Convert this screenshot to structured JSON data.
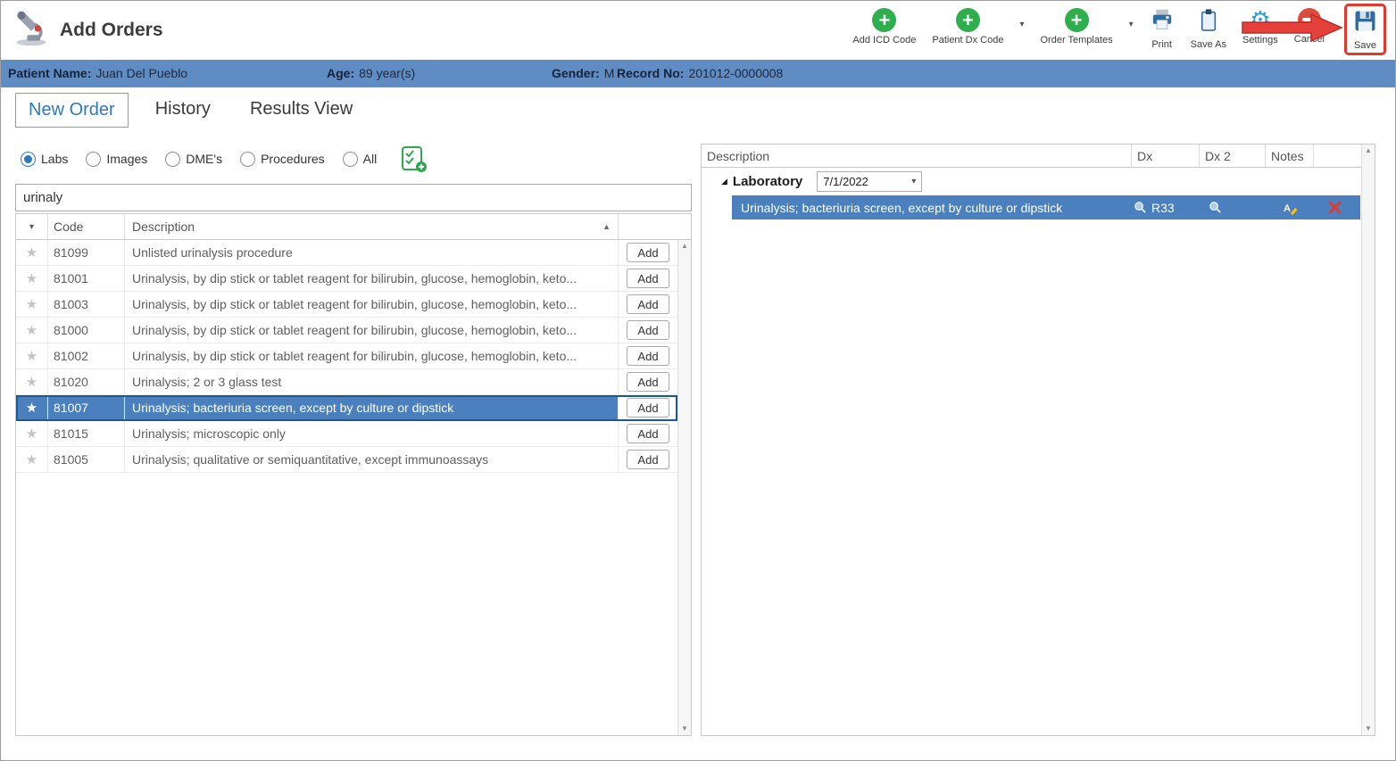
{
  "window": {
    "title": "Add Orders"
  },
  "toolbar": {
    "add_icd": "Add ICD Code",
    "patient_dx": "Patient Dx Code",
    "order_templates": "Order Templates",
    "print": "Print",
    "save_as": "Save As",
    "settings": "Settings",
    "cancel": "Cancel",
    "save": "Save"
  },
  "patient_bar": {
    "name_label": "Patient Name:",
    "name_value": "Juan Del Pueblo",
    "age_label": "Age:",
    "age_value": "89 year(s)",
    "gender_label": "Gender:",
    "gender_value": "M",
    "record_label": "Record No:",
    "record_value": "201012-0000008"
  },
  "tabs": {
    "new_order": "New Order",
    "history": "History",
    "results_view": "Results View"
  },
  "filters": {
    "labs": "Labs",
    "images": "Images",
    "dmes": "DME's",
    "procedures": "Procedures",
    "all": "All",
    "selected": "Labs"
  },
  "search": {
    "value": "urinaly"
  },
  "codes_table": {
    "col_code": "Code",
    "col_description": "Description",
    "add_label": "Add",
    "selected_code": "81007",
    "rows": [
      {
        "code": "81099",
        "description": "Unlisted urinalysis procedure"
      },
      {
        "code": "81001",
        "description": "Urinalysis, by dip stick or tablet reagent for bilirubin, glucose, hemoglobin, keto..."
      },
      {
        "code": "81003",
        "description": "Urinalysis, by dip stick or tablet reagent for bilirubin, glucose, hemoglobin, keto..."
      },
      {
        "code": "81000",
        "description": "Urinalysis, by dip stick or tablet reagent for bilirubin, glucose, hemoglobin, keto..."
      },
      {
        "code": "81002",
        "description": "Urinalysis, by dip stick or tablet reagent for bilirubin, glucose, hemoglobin, keto..."
      },
      {
        "code": "81020",
        "description": "Urinalysis; 2 or 3 glass test"
      },
      {
        "code": "81007",
        "description": "Urinalysis; bacteriuria screen, except by culture or dipstick"
      },
      {
        "code": "81015",
        "description": "Urinalysis; microscopic only"
      },
      {
        "code": "81005",
        "description": "Urinalysis; qualitative or semiquantitative, except immunoassays"
      }
    ]
  },
  "orders_panel": {
    "col_description": "Description",
    "col_dx": "Dx",
    "col_dx2": "Dx 2",
    "col_notes": "Notes",
    "group_label": "Laboratory",
    "group_date": "7/1/2022",
    "rows": [
      {
        "description": "Urinalysis; bacteriuria screen, except by culture or dipstick",
        "dx": "R33"
      }
    ]
  },
  "icons": {
    "plus": "+",
    "caret_down": "▾",
    "sort_asc": "▲",
    "scroll_up": "▲",
    "scroll_down": "▼",
    "expander": "◢",
    "star": "★",
    "gear": "⚙"
  },
  "colors": {
    "accent_blue": "#2e79be",
    "selection_blue": "#4a80bd",
    "patient_bar_blue": "#5e8cc3",
    "toolbar_green": "#2fae4d",
    "cancel_red": "#e04b3f",
    "annotation_red": "#e2382f"
  }
}
